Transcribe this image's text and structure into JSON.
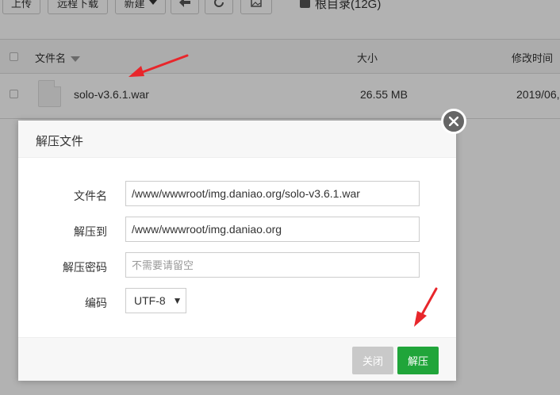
{
  "toolbar": {
    "upload_label": "上传",
    "remote_download_label": "远程下载",
    "new_label": "新建",
    "back_icon": "arrow-left-icon",
    "refresh_icon": "refresh-icon",
    "image_icon": "image-icon"
  },
  "path": {
    "label": "根目录(12G)",
    "icon": "hard-disk-icon"
  },
  "table": {
    "headers": {
      "name": "文件名",
      "size": "大小",
      "modified": "修改时间"
    },
    "rows": [
      {
        "name": "solo-v3.6.1.war",
        "size": "26.55 MB",
        "modified": "2019/06,"
      }
    ]
  },
  "dialog": {
    "title": "解压文件",
    "fields": {
      "filename_label": "文件名",
      "filename_value": "/www/wwwroot/img.daniao.org/solo-v3.6.1.war",
      "extract_to_label": "解压到",
      "extract_to_value": "/www/wwwroot/img.daniao.org",
      "password_label": "解压密码",
      "password_placeholder": "不需要请留空",
      "encoding_label": "编码",
      "encoding_value": "UTF-8"
    },
    "buttons": {
      "close_label": "关闭",
      "extract_label": "解压"
    }
  },
  "colors": {
    "primary_green": "#20a53a",
    "annotation_red": "#e8262b",
    "disabled_gray": "#c9c9c9"
  }
}
